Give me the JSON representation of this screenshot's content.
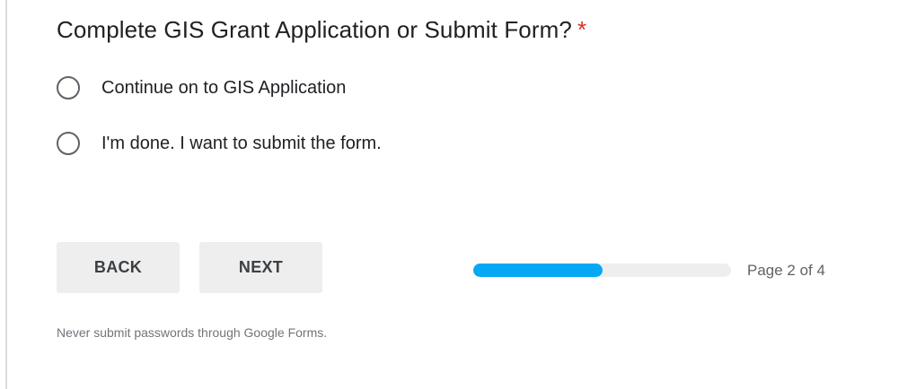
{
  "question": {
    "title": "Complete GIS Grant Application or Submit Form?",
    "required_marker": "*",
    "options": [
      {
        "label": "Continue on to GIS Application",
        "selected": false
      },
      {
        "label": "I'm done. I want to submit the form.",
        "selected": false
      }
    ]
  },
  "navigation": {
    "back_label": "BACK",
    "next_label": "NEXT"
  },
  "progress": {
    "fraction": 0.5,
    "page_text": "Page 2 of 4",
    "fill_color": "#03a9f4",
    "track_color": "#eeeeee"
  },
  "footer": {
    "note": "Never submit passwords through Google Forms."
  },
  "colors": {
    "required_star": "#d93025",
    "button_bg": "#eeeeee"
  }
}
